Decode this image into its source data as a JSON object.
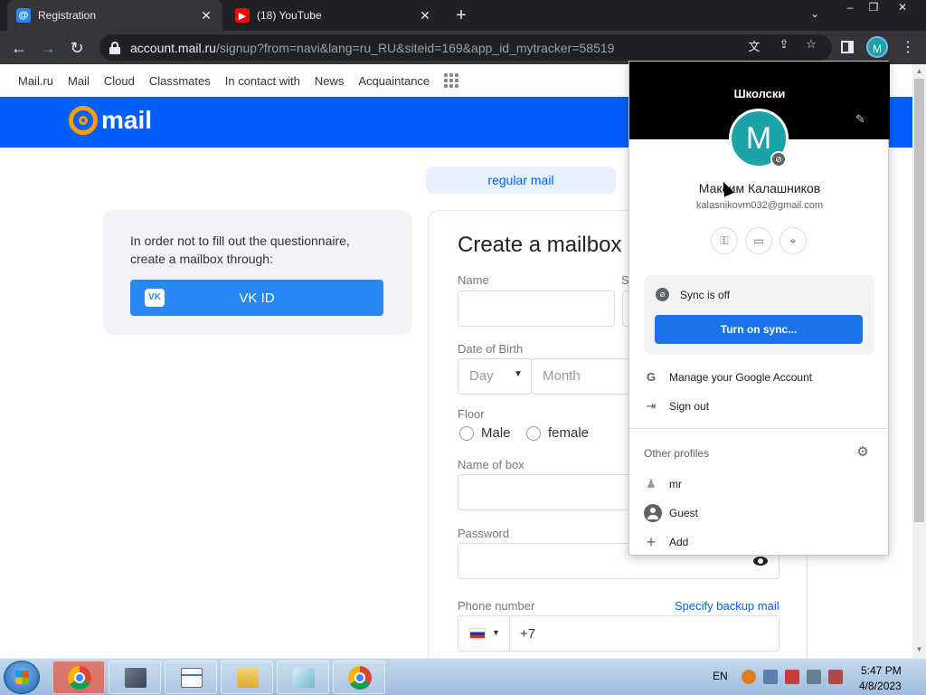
{
  "browser": {
    "tabs": [
      {
        "title": "Registration",
        "favicon": "mail-at-icon"
      },
      {
        "title": "(18) YouTube",
        "favicon": "youtube-icon"
      }
    ],
    "url_host": "account.mail.ru",
    "url_rest": "/signup?from=navi&lang=ru_RU&siteid=169&app_id_mytracker=58519",
    "profile_initial": "M",
    "new_tab_glyph": "+",
    "close_glyph": "✕"
  },
  "site": {
    "nav_items": [
      "Mail.ru",
      "Mail",
      "Cloud",
      "Classmates",
      "In contact with",
      "News",
      "Acquaintance"
    ],
    "logo_text": "mail",
    "regular_mail": "regular mail",
    "vk_card": {
      "text": "In order not to fill out the questionnaire, create a mailbox through:",
      "button_label": "VK ID",
      "logo_text": "VK"
    },
    "form": {
      "title": "Create a mailbox",
      "name_label": "Name",
      "surname_label_partial": "S",
      "dob_label": "Date of Birth",
      "day_placeholder": "Day",
      "month_placeholder": "Month",
      "floor_label": "Floor",
      "male_label": "Male",
      "female_label": "female",
      "box_label": "Name of box",
      "password_label": "Password",
      "phone_label": "Phone number",
      "backup_link": "Specify backup mail",
      "phone_prefix": "+7"
    }
  },
  "profile_popup": {
    "banner_title": "Школски",
    "avatar_initial": "M",
    "name": "Максим Калашников",
    "email": "kalasnikovm032@gmail.com",
    "sync_status": "Sync is off",
    "sync_button": "Turn on sync...",
    "manage_account": "Manage your Google Account",
    "sign_out": "Sign out",
    "other_profiles_label": "Other profiles",
    "profiles": [
      "mr",
      "Guest"
    ],
    "add_label": "Add"
  },
  "taskbar": {
    "language": "EN",
    "time": "5:47 PM",
    "date": "4/8/2023"
  },
  "colors": {
    "brand_blue": "#005ff9",
    "vk_blue": "#2787f5",
    "google_blue": "#1a73e8",
    "avatar_teal": "#1aa4a8"
  }
}
